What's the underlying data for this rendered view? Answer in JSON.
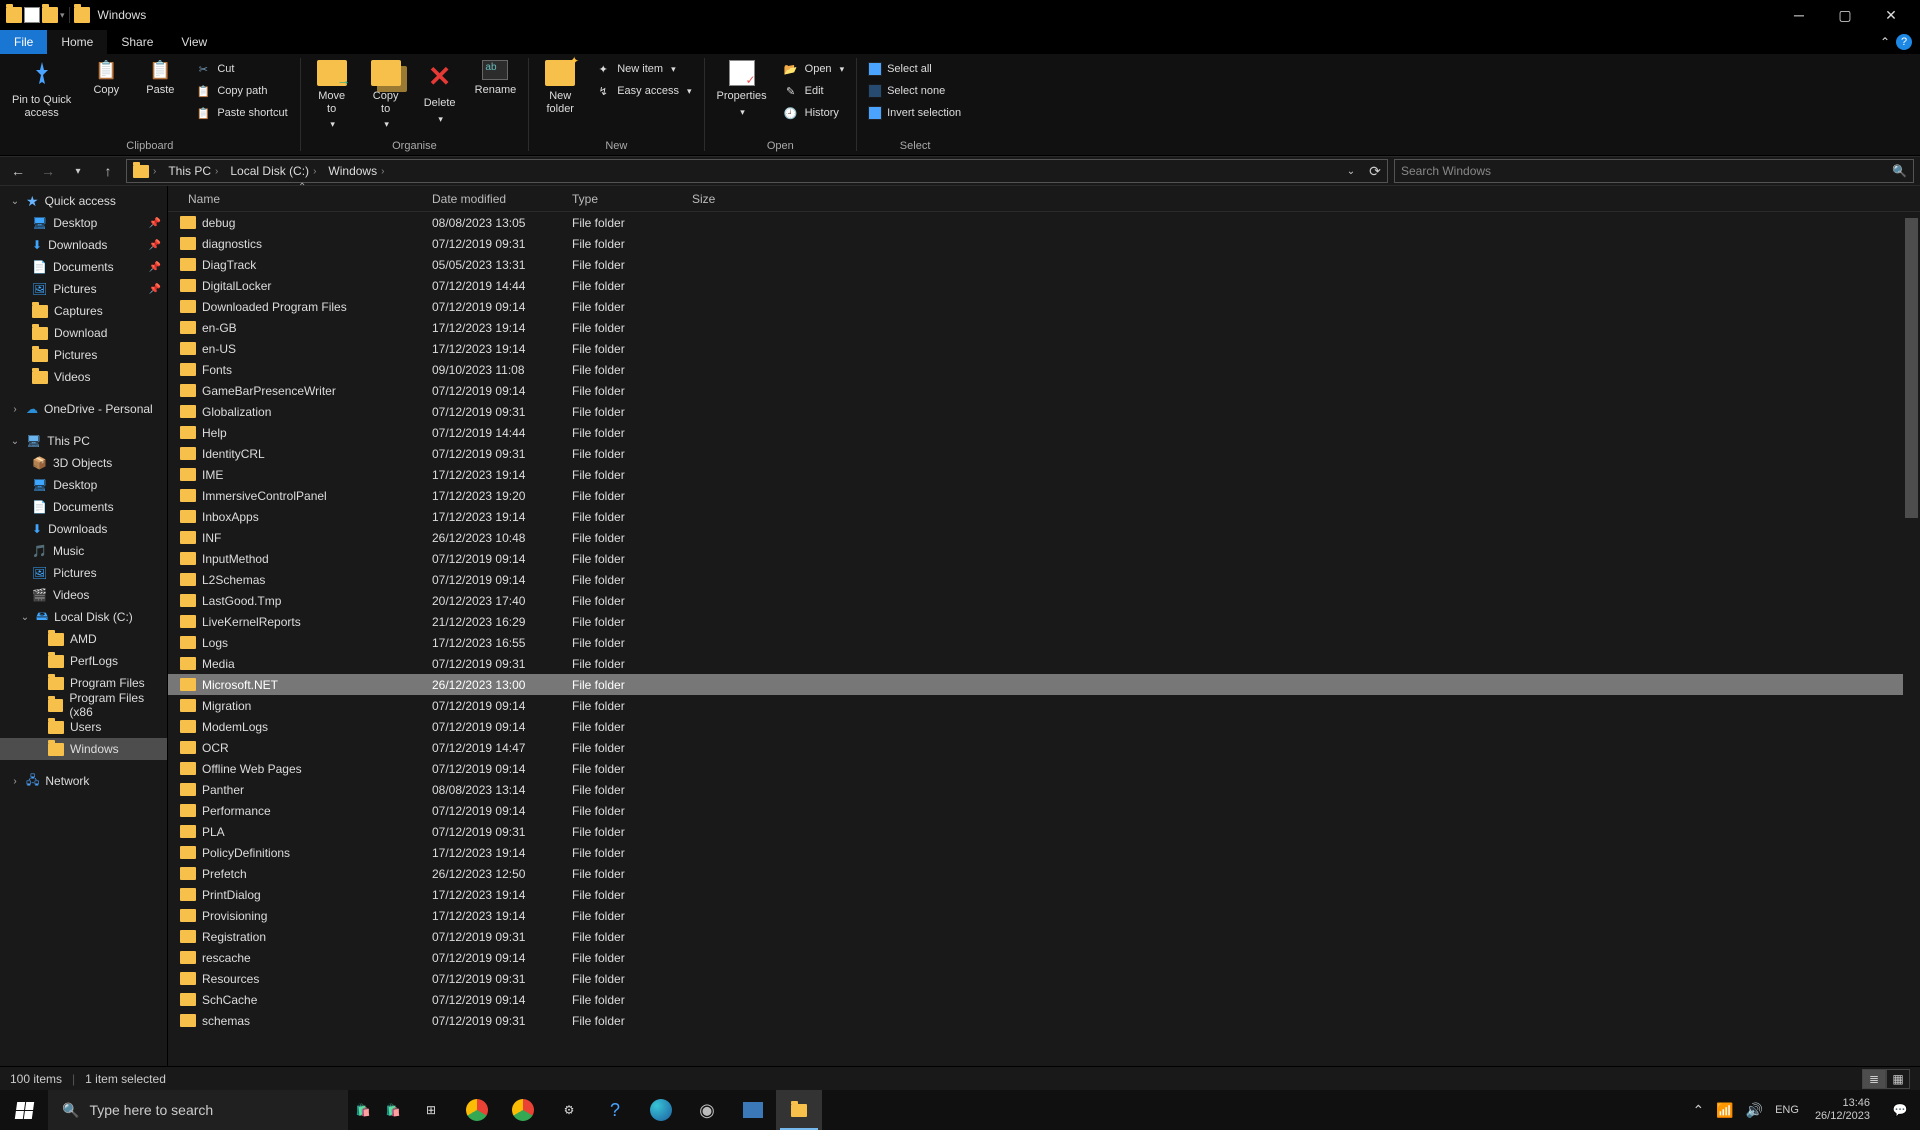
{
  "title": "Windows",
  "tabs": {
    "file": "File",
    "home": "Home",
    "share": "Share",
    "view": "View"
  },
  "ribbon": {
    "clipboard": {
      "pin": "Pin to Quick\naccess",
      "copy": "Copy",
      "paste": "Paste",
      "cut": "Cut",
      "copypath": "Copy path",
      "pasteshortcut": "Paste shortcut",
      "label": "Clipboard"
    },
    "organise": {
      "moveto": "Move\nto",
      "copyto": "Copy\nto",
      "delete": "Delete",
      "rename": "Rename",
      "label": "Organise"
    },
    "new": {
      "newfolder": "New\nfolder",
      "newitem": "New item",
      "easyaccess": "Easy access",
      "label": "New"
    },
    "open": {
      "properties": "Properties",
      "open": "Open",
      "edit": "Edit",
      "history": "History",
      "label": "Open"
    },
    "select": {
      "selectall": "Select all",
      "selectnone": "Select none",
      "invert": "Invert selection",
      "label": "Select"
    }
  },
  "breadcrumbs": [
    "This PC",
    "Local Disk (C:)",
    "Windows"
  ],
  "search_placeholder": "Search Windows",
  "nav": {
    "quick": "Quick access",
    "pinned": [
      {
        "label": "Desktop",
        "icon": "desktop",
        "pin": true
      },
      {
        "label": "Downloads",
        "icon": "downloads",
        "pin": true
      },
      {
        "label": "Documents",
        "icon": "documents",
        "pin": true
      },
      {
        "label": "Pictures",
        "icon": "pictures",
        "pin": true
      },
      {
        "label": "Captures",
        "icon": "folder"
      },
      {
        "label": "Download",
        "icon": "folder"
      },
      {
        "label": "Pictures",
        "icon": "folder"
      },
      {
        "label": "Videos",
        "icon": "folder"
      }
    ],
    "onedrive": "OneDrive - Personal",
    "thispc": "This PC",
    "thispc_items": [
      {
        "label": "3D Objects"
      },
      {
        "label": "Desktop"
      },
      {
        "label": "Documents"
      },
      {
        "label": "Downloads"
      },
      {
        "label": "Music"
      },
      {
        "label": "Pictures"
      },
      {
        "label": "Videos"
      },
      {
        "label": "Local Disk (C:)",
        "expandable": true,
        "expanded": true,
        "children": [
          {
            "label": "AMD"
          },
          {
            "label": "PerfLogs"
          },
          {
            "label": "Program Files"
          },
          {
            "label": "Program Files (x86"
          },
          {
            "label": "Users"
          },
          {
            "label": "Windows",
            "selected": true
          }
        ]
      }
    ],
    "network": "Network"
  },
  "columns": {
    "name": "Name",
    "date": "Date modified",
    "type": "Type",
    "size": "Size"
  },
  "files": [
    {
      "name": "debug",
      "date": "08/08/2023 13:05",
      "type": "File folder"
    },
    {
      "name": "diagnostics",
      "date": "07/12/2019 09:31",
      "type": "File folder"
    },
    {
      "name": "DiagTrack",
      "date": "05/05/2023 13:31",
      "type": "File folder"
    },
    {
      "name": "DigitalLocker",
      "date": "07/12/2019 14:44",
      "type": "File folder"
    },
    {
      "name": "Downloaded Program Files",
      "date": "07/12/2019 09:14",
      "type": "File folder"
    },
    {
      "name": "en-GB",
      "date": "17/12/2023 19:14",
      "type": "File folder"
    },
    {
      "name": "en-US",
      "date": "17/12/2023 19:14",
      "type": "File folder"
    },
    {
      "name": "Fonts",
      "date": "09/10/2023 11:08",
      "type": "File folder"
    },
    {
      "name": "GameBarPresenceWriter",
      "date": "07/12/2019 09:14",
      "type": "File folder"
    },
    {
      "name": "Globalization",
      "date": "07/12/2019 09:31",
      "type": "File folder"
    },
    {
      "name": "Help",
      "date": "07/12/2019 14:44",
      "type": "File folder"
    },
    {
      "name": "IdentityCRL",
      "date": "07/12/2019 09:31",
      "type": "File folder"
    },
    {
      "name": "IME",
      "date": "17/12/2023 19:14",
      "type": "File folder"
    },
    {
      "name": "ImmersiveControlPanel",
      "date": "17/12/2023 19:20",
      "type": "File folder"
    },
    {
      "name": "InboxApps",
      "date": "17/12/2023 19:14",
      "type": "File folder"
    },
    {
      "name": "INF",
      "date": "26/12/2023 10:48",
      "type": "File folder"
    },
    {
      "name": "InputMethod",
      "date": "07/12/2019 09:14",
      "type": "File folder"
    },
    {
      "name": "L2Schemas",
      "date": "07/12/2019 09:14",
      "type": "File folder"
    },
    {
      "name": "LastGood.Tmp",
      "date": "20/12/2023 17:40",
      "type": "File folder"
    },
    {
      "name": "LiveKernelReports",
      "date": "21/12/2023 16:29",
      "type": "File folder"
    },
    {
      "name": "Logs",
      "date": "17/12/2023 16:55",
      "type": "File folder"
    },
    {
      "name": "Media",
      "date": "07/12/2019 09:31",
      "type": "File folder"
    },
    {
      "name": "Microsoft.NET",
      "date": "26/12/2023 13:00",
      "type": "File folder",
      "selected": true
    },
    {
      "name": "Migration",
      "date": "07/12/2019 09:14",
      "type": "File folder"
    },
    {
      "name": "ModemLogs",
      "date": "07/12/2019 09:14",
      "type": "File folder"
    },
    {
      "name": "OCR",
      "date": "07/12/2019 14:47",
      "type": "File folder"
    },
    {
      "name": "Offline Web Pages",
      "date": "07/12/2019 09:14",
      "type": "File folder"
    },
    {
      "name": "Panther",
      "date": "08/08/2023 13:14",
      "type": "File folder"
    },
    {
      "name": "Performance",
      "date": "07/12/2019 09:14",
      "type": "File folder"
    },
    {
      "name": "PLA",
      "date": "07/12/2019 09:31",
      "type": "File folder"
    },
    {
      "name": "PolicyDefinitions",
      "date": "17/12/2023 19:14",
      "type": "File folder"
    },
    {
      "name": "Prefetch",
      "date": "26/12/2023 12:50",
      "type": "File folder"
    },
    {
      "name": "PrintDialog",
      "date": "17/12/2023 19:14",
      "type": "File folder"
    },
    {
      "name": "Provisioning",
      "date": "17/12/2023 19:14",
      "type": "File folder"
    },
    {
      "name": "Registration",
      "date": "07/12/2019 09:31",
      "type": "File folder"
    },
    {
      "name": "rescache",
      "date": "07/12/2019 09:14",
      "type": "File folder"
    },
    {
      "name": "Resources",
      "date": "07/12/2019 09:31",
      "type": "File folder"
    },
    {
      "name": "SchCache",
      "date": "07/12/2019 09:14",
      "type": "File folder"
    },
    {
      "name": "schemas",
      "date": "07/12/2019 09:31",
      "type": "File folder"
    }
  ],
  "status": {
    "items": "100 items",
    "selected": "1 item selected"
  },
  "taskbar": {
    "search": "Type here to search",
    "time": "13:46",
    "date": "26/12/2023"
  }
}
